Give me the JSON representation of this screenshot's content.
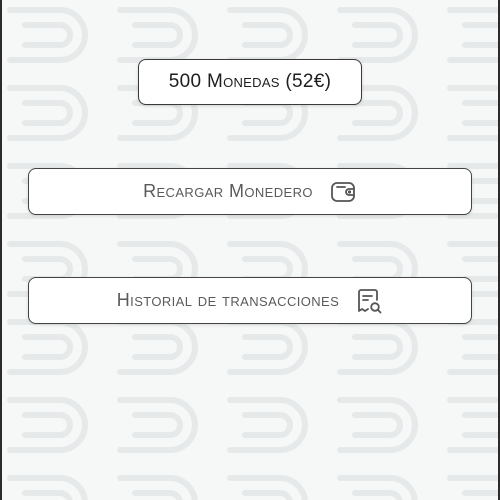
{
  "balance": {
    "text": "500 Monedas (52€)"
  },
  "actions": {
    "recharge": {
      "label": "Recargar Monedero",
      "icon": "wallet-icon"
    },
    "history": {
      "label": "Historial de transacciones",
      "icon": "receipt-search-icon"
    }
  },
  "colors": {
    "background": "#f6f7f7",
    "button_border": "#444444",
    "label_text": "#5a5a5a"
  }
}
